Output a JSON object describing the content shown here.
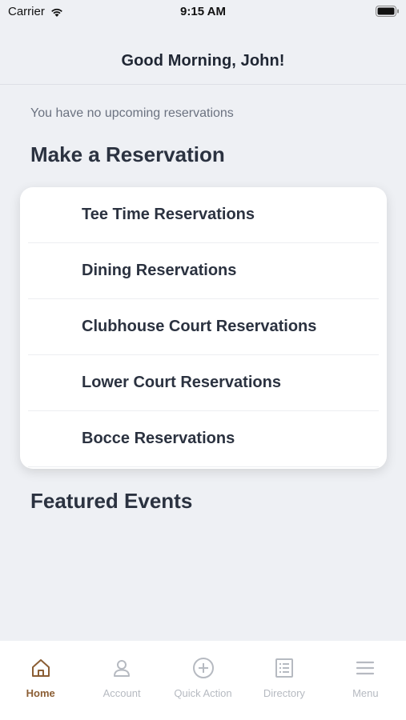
{
  "status_bar": {
    "carrier": "Carrier",
    "time": "9:15 AM"
  },
  "header": {
    "title": "Good Morning, John!"
  },
  "main": {
    "no_reservations": "You have no upcoming reservations",
    "make_reservation_title": "Make a Reservation",
    "reservations": [
      "Tee Time Reservations",
      "Dining Reservations",
      "Clubhouse Court Reservations",
      "Lower Court Reservations",
      "Bocce Reservations"
    ],
    "featured_events_title": "Featured Events"
  },
  "tabbar": {
    "tabs": [
      {
        "label": "Home",
        "icon": "home-icon"
      },
      {
        "label": "Account",
        "icon": "account-icon"
      },
      {
        "label": "Quick Action",
        "icon": "plus-circle-icon"
      },
      {
        "label": "Directory",
        "icon": "directory-icon"
      },
      {
        "label": "Menu",
        "icon": "menu-icon"
      }
    ],
    "active_color": "#8b5e34",
    "inactive_color": "#b6bac1"
  }
}
